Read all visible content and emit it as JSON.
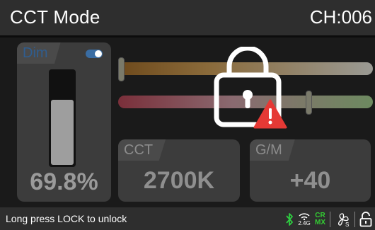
{
  "header": {
    "title": "CCT Mode",
    "channel": "CH:006"
  },
  "dimmer": {
    "label": "Dim",
    "value_text": "69.8%",
    "level": 0.698,
    "toggle_on": true
  },
  "sliders": {
    "cct_position": 0.0,
    "gm_position": 0.75
  },
  "cct": {
    "label": "CCT",
    "value": "2700K"
  },
  "gm": {
    "label": "G/M",
    "value": "+40"
  },
  "lock": {
    "icon": "lock-warning-icon",
    "warning_color": "#e53935"
  },
  "footer": {
    "message": "Long press LOCK to unlock",
    "icons": [
      "bluetooth-icon",
      "wifi-2.4g-icon",
      "crmx-icon",
      "fan-icon",
      "unlock-icon"
    ],
    "band_label": "2.4G",
    "crmx_top": "CR",
    "crmx_bottom": "MX",
    "fan_mode": "S",
    "bluetooth_color": "#2ecc40",
    "crmx_color": "#33cc33"
  }
}
